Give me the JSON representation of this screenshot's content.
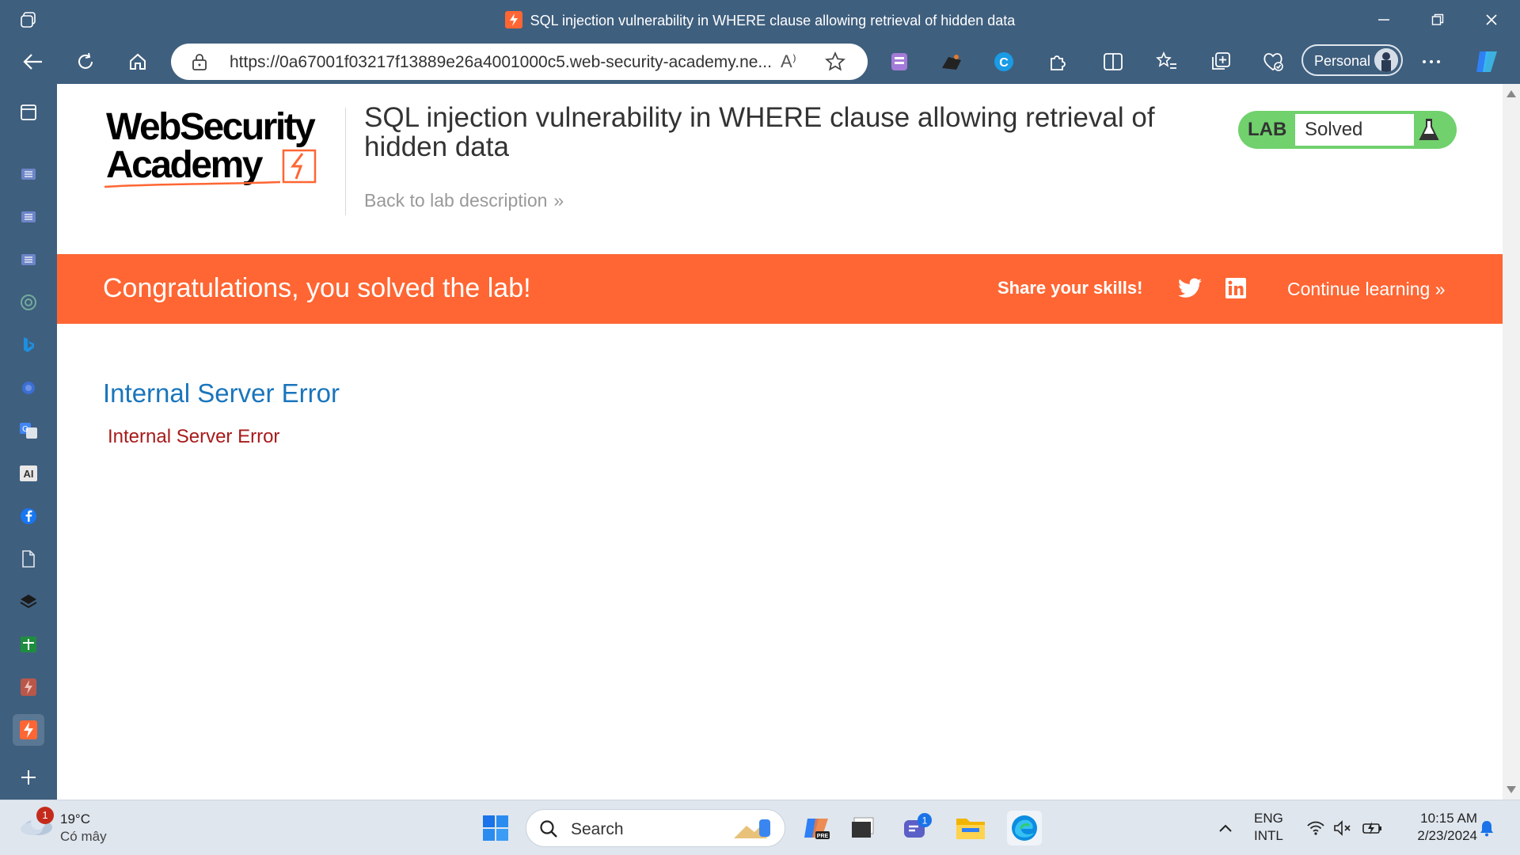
{
  "browser": {
    "window_title": "SQL injection vulnerability in WHERE clause allowing retrieval of hidden data",
    "address_url": "https://0a67001f03217f13889e26a4001000c5.web-security-academy.ne...",
    "read_aloud_label": "A⁾",
    "profile_label": "Personal"
  },
  "page": {
    "logo_line1": "WebSecurity",
    "logo_line2": "Academy",
    "lab_title": "SQL injection vulnerability in WHERE clause allowing retrieval of hidden data",
    "back_link": "Back to lab description",
    "lab_badge_label": "LAB",
    "lab_status": "Solved",
    "banner_message": "Congratulations, you solved the lab!",
    "share_label": "Share your skills!",
    "continue_label": "Continue learning",
    "error_heading": "Internal Server Error",
    "error_body": "Internal Server Error"
  },
  "colors": {
    "brand_orange": "#ff6633",
    "lab_green": "#70d16d",
    "heading_blue": "#1a75bc",
    "error_red": "#a81a1a",
    "browser_chrome": "#3f5f7e"
  },
  "taskbar": {
    "weather_temp": "19°C",
    "weather_condition": "Có mây",
    "weather_badge": "1",
    "search_label": "Search",
    "teams_badge": "1",
    "lang_line1": "ENG",
    "lang_line2": "INTL",
    "time": "10:15 AM",
    "date": "2/23/2024"
  }
}
